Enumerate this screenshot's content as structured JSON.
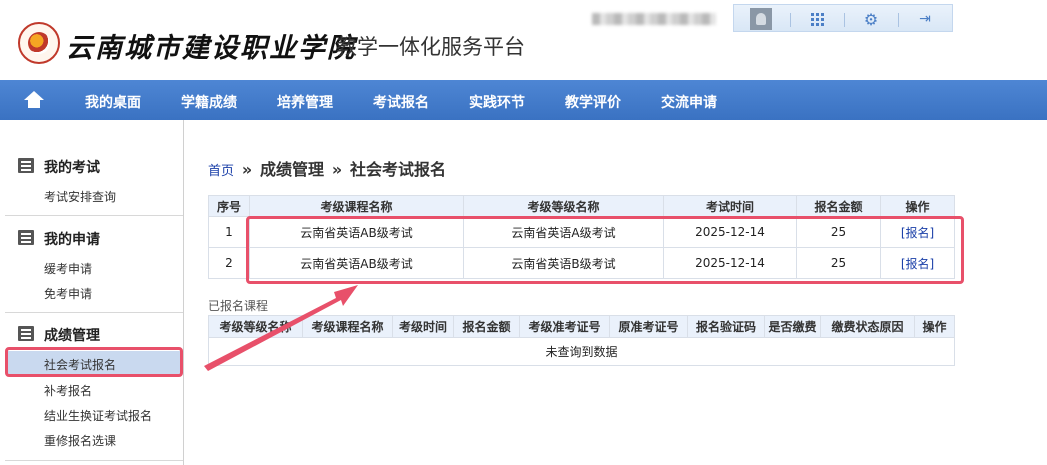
{
  "header": {
    "school_name": "云南城市建设职业学院",
    "platform_name": "教学一体化服务平台"
  },
  "nav": {
    "items": [
      "我的桌面",
      "学籍成绩",
      "培养管理",
      "考试报名",
      "实践环节",
      "教学评价",
      "交流申请"
    ]
  },
  "sidebar": {
    "sections": [
      {
        "title": "我的考试",
        "items": [
          "考试安排查询"
        ]
      },
      {
        "title": "我的申请",
        "items": [
          "缓考申请",
          "免考申请"
        ]
      },
      {
        "title": "成绩管理",
        "items": [
          "社会考试报名",
          "补考报名",
          "结业生换证考试报名",
          "重修报名选课"
        ]
      }
    ],
    "active_item": "社会考试报名"
  },
  "breadcrumb": {
    "home": "首页",
    "sep": "»",
    "section": "成绩管理",
    "current": "社会考试报名"
  },
  "exam_table": {
    "headers": [
      "序号",
      "考级课程名称",
      "考级等级名称",
      "考试时间",
      "报名金额",
      "操作"
    ],
    "rows": [
      [
        "1",
        "云南省英语AB级考试",
        "云南省英语A级考试",
        "2025-12-14",
        "25",
        "[报名]"
      ],
      [
        "2",
        "云南省英语AB级考试",
        "云南省英语B级考试",
        "2025-12-14",
        "25",
        "[报名]"
      ]
    ]
  },
  "registered": {
    "title": "已报名课程",
    "headers": [
      "考级等级名称",
      "考级课程名称",
      "考级时间",
      "报名金额",
      "考级准考证号",
      "原准考证号",
      "报名验证码",
      "是否缴费",
      "缴费状态原因",
      "操作"
    ],
    "empty_text": "未查询到数据"
  },
  "colors": {
    "nav_bg": "#3f78c8",
    "highlight": "#e8506a",
    "active_item_bg": "#c9d9ef",
    "link": "#1a3fa8"
  },
  "icons": [
    "school-logo-icon",
    "home-icon",
    "avatar-icon",
    "apps-grid-icon",
    "gear-icon",
    "logout-icon",
    "section-list-icon"
  ]
}
